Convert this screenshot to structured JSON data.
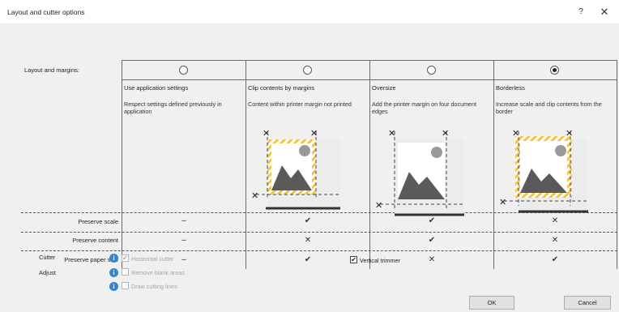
{
  "window": {
    "title": "Layout and cutter options",
    "help": "?",
    "close": "✕"
  },
  "layout_label": "Layout and margins:",
  "options": [
    {
      "name": "Use application settings",
      "desc": "Respect settings defined previously in application",
      "selected": false
    },
    {
      "name": "Clip contents by margins",
      "desc": "Content within printer margin not printed",
      "selected": false
    },
    {
      "name": "Oversize",
      "desc": "Add the printer margin on four document edges",
      "selected": false
    },
    {
      "name": "Borderless",
      "desc": "Increase scale and clip contents from the border",
      "selected": true
    }
  ],
  "rows": [
    {
      "label": "Preserve scale",
      "values": [
        "–",
        "✔",
        "✔",
        "✕"
      ]
    },
    {
      "label": "Preserve content",
      "values": [
        "–",
        "✕",
        "✔",
        "✕"
      ]
    },
    {
      "label": "Preserve paper size",
      "values": [
        "–",
        "✔",
        "✕",
        "✔"
      ]
    }
  ],
  "cutter_label": "Cutter",
  "adjust_label": "Adjust",
  "info_glyph": "i",
  "checkboxes": {
    "horizontal_cutter": {
      "label": "Horizontal cutter",
      "checked": true,
      "enabled": false
    },
    "remove_blank": {
      "label": "Remove blank areas",
      "checked": false,
      "enabled": false
    },
    "draw_lines": {
      "label": "Draw cutting lines",
      "checked": false,
      "enabled": false
    },
    "vertical_trimmer": {
      "label": "Vertical trimmer",
      "checked": true,
      "enabled": true
    }
  },
  "check_glyph": "✔",
  "buttons": {
    "ok": "OK",
    "cancel": "Cancel"
  },
  "colors": {
    "accent": "#2f86d6",
    "hatch": "#f5c242",
    "photo": "#5a5a5a"
  }
}
